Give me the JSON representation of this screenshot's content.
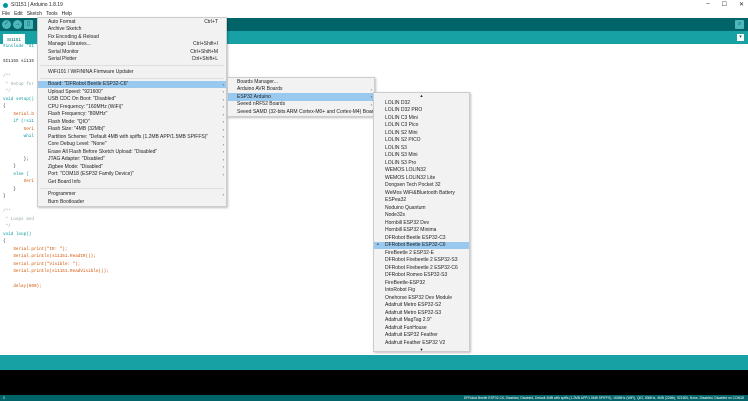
{
  "title": "SI1151 | Arduino 1.8.19",
  "menubar": [
    "File",
    "Edit",
    "Sketch",
    "Tools",
    "Help"
  ],
  "tab": "SI1151",
  "code": [
    [
      "k",
      "#include \"SI"
    ],
    [
      "",
      ""
    ],
    [
      "",
      "SI115X si115"
    ],
    [
      "",
      ""
    ],
    [
      "c",
      "/**"
    ],
    [
      "c",
      " * Setup for"
    ],
    [
      "c",
      " */"
    ],
    [
      "k",
      "void setup()"
    ],
    [
      "",
      "{"
    ],
    [
      "o",
      "    Serial.b"
    ],
    [
      "k",
      "    if (!si1"
    ],
    [
      "o",
      "        Seri"
    ],
    [
      "k",
      "        whil"
    ],
    [
      "",
      ""
    ],
    [
      "",
      ""
    ],
    [
      "",
      "        };"
    ],
    [
      "",
      "    }"
    ],
    [
      "k",
      "    else {"
    ],
    [
      "o",
      "        Seri"
    ],
    [
      "",
      "    }"
    ],
    [
      "",
      "}"
    ],
    [
      "",
      ""
    ],
    [
      "c",
      "/**"
    ],
    [
      "c",
      " * Loops and"
    ],
    [
      "c",
      " */"
    ],
    [
      "k",
      "void loop()"
    ],
    [
      "",
      "{"
    ],
    [
      "o",
      "    Serial.print(\"IR: \");"
    ],
    [
      "o",
      "    Serial.println(si1151.ReadIR());"
    ],
    [
      "o",
      "    Serial.print(\"Visible: \");"
    ],
    [
      "o",
      "    Serial.println(si1151.ReadVisible());"
    ],
    [
      "",
      ""
    ],
    [
      "o",
      "    delay(500);"
    ]
  ],
  "tools_menu": [
    {
      "label": "Auto Format",
      "shortcut": "Ctrl+T"
    },
    {
      "label": "Archive Sketch"
    },
    {
      "label": "Fix Encoding & Reload"
    },
    {
      "label": "Manage Libraries...",
      "shortcut": "Ctrl+Shift+I"
    },
    {
      "label": "Serial Monitor",
      "shortcut": "Ctrl+Shift+M"
    },
    {
      "label": "Serial Plotter",
      "shortcut": "Ctrl+Shift+L"
    },
    {
      "sep": true
    },
    {
      "label": "WiFi101 / WiFiNINA Firmware Updater"
    },
    {
      "sep": true
    },
    {
      "label": "Board: \"DFRobot Beetle ESP32-C6\"",
      "sub": true,
      "selected": true
    },
    {
      "label": "Upload Speed: \"921600\"",
      "sub": true
    },
    {
      "label": "USB CDC On Boot: \"Disabled\"",
      "sub": true
    },
    {
      "label": "CPU Frequency: \"160MHz (WiFi)\"",
      "sub": true
    },
    {
      "label": "Flash Frequency: \"80MHz\"",
      "sub": true
    },
    {
      "label": "Flash Mode: \"QIO\"",
      "sub": true
    },
    {
      "label": "Flash Size: \"4MB (32Mb)\"",
      "sub": true
    },
    {
      "label": "Partition Scheme: \"Default 4MB with spiffs (1.2MB APP/1.5MB SPIFFS)\"",
      "sub": true
    },
    {
      "label": "Core Debug Level: \"None\"",
      "sub": true
    },
    {
      "label": "Erase All Flash Before Sketch Upload: \"Disabled\"",
      "sub": true
    },
    {
      "label": "JTAG Adapter: \"Disabled\"",
      "sub": true
    },
    {
      "label": "Zigbee Mode: \"Disabled\"",
      "sub": true
    },
    {
      "label": "Port: \"COM18 (ESP32 Family Device)\"",
      "sub": true
    },
    {
      "label": "Get Board Info"
    },
    {
      "sep": true
    },
    {
      "label": "Programmer",
      "sub": true
    },
    {
      "label": "Burn Bootloader"
    }
  ],
  "boards_menu": [
    {
      "label": "Boards Manager..."
    },
    {
      "label": "Arduino AVR Boards",
      "sub": true
    },
    {
      "label": "ESP32 Arduino",
      "sub": true,
      "selected": true
    },
    {
      "label": "Seeed nRF52 Boards",
      "sub": true
    },
    {
      "label": "Seeed SAMD (32-bits ARM Cortex-M0+ and Cortex-M4) Boards",
      "sub": true
    }
  ],
  "esp32_boards": [
    "LOLIN D32",
    "LOLIN D32 PRO",
    "LOLIN C3 Mini",
    "LOLIN C3 Pico",
    "LOLIN S2 Mini",
    "LOLIN S2 PICO",
    "LOLIN S3",
    "LOLIN S3 Mini",
    "LOLIN S3 Pro",
    "WEMOS LOLIN32",
    "WEMOS LOLIN32 Lite",
    "Dongsen Tech Pocket 32",
    "WeMos WiFi&Bluetooth Battery",
    "ESPea32",
    "Noduino Quantum",
    "Node32s",
    "Hornbill ESP32 Dev",
    "Hornbill ESP32 Minima",
    "DFRobot Beetle ESP32-C3",
    "DFRobot Beetle ESP32-C6",
    "FireBeetle 2 ESP32-E",
    "DFRobot Firebeetle 2 ESP32-S3",
    "DFRobot Firebeetle 2 ESP32-C6",
    "DFRobot Romeo ESP32-S3",
    "FireBeetle-ESP32",
    "IntoRobot Fig",
    "Onehorse ESP32 Dev Module",
    "Adafruit Metro ESP32-S2",
    "Adafruit Metro ESP32-S3",
    "Adafruit MagTag 2.9\"",
    "Adafruit FunHouse",
    "Adafruit ESP32 Feather",
    "Adafruit Feather ESP32 V2"
  ],
  "esp32_selected": "DFRobot Beetle ESP32-C6",
  "status": {
    "line": "2",
    "board": "DFRobot Beetle ESP32-C6, Disabled, Disabled, Default 4MB with spiffs (1.2MB APP/1.5MB SPIFFS), 160MHz (WiFi), QIO, 80MHz, 4MB (32Mb), 921600, None, Disabled, Disabled on COM18"
  },
  "colors": {
    "toolbar": "#006468",
    "tabs": "#17a1a5",
    "selection": "#99c9ef"
  }
}
